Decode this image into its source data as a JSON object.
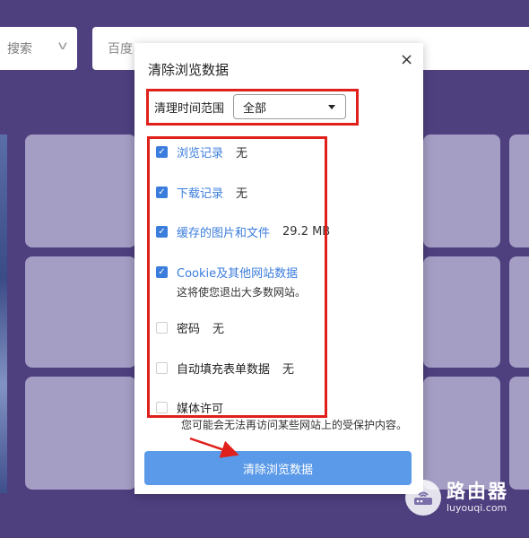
{
  "background": {
    "search_engine_label": "搜索",
    "search_input_value": "百度"
  },
  "dialog": {
    "title": "清除浏览数据",
    "close_glyph": "×",
    "time_range": {
      "label": "清理时间范围",
      "selected": "全部"
    },
    "options": [
      {
        "label": "浏览记录",
        "value": "无",
        "checked": true
      },
      {
        "label": "下载记录",
        "value": "无",
        "checked": true
      },
      {
        "label": "缓存的图片和文件",
        "value": "29.2 MB",
        "checked": true
      },
      {
        "label": "Cookie及其他网站数据",
        "description": "这将使您退出大多数网站。",
        "checked": true
      },
      {
        "label": "密码",
        "value": "无",
        "checked": false
      },
      {
        "label": "自动填充表单数据",
        "value": "无",
        "checked": false
      },
      {
        "label": "媒体许可",
        "checked": false
      }
    ],
    "warning_text": "您可能会无法再访问某些网站上的受保护内容。",
    "clear_button_label": "清除浏览数据"
  },
  "annotations": {
    "color": "#e0201b"
  },
  "watermark": {
    "title": "路由器",
    "url": "luyouqi.com"
  },
  "colors": {
    "background": "#4e3f7f",
    "tile": "#a49dc4",
    "accent_blue": "#3b7ddd",
    "button_blue": "#5b9ae8"
  },
  "icons": {
    "close": "close-icon",
    "checkbox": "checkbox-check-icon",
    "dropdown": "caret-down-icon",
    "chevron": "chevron-down-icon",
    "watermark": "router-logo-icon"
  }
}
